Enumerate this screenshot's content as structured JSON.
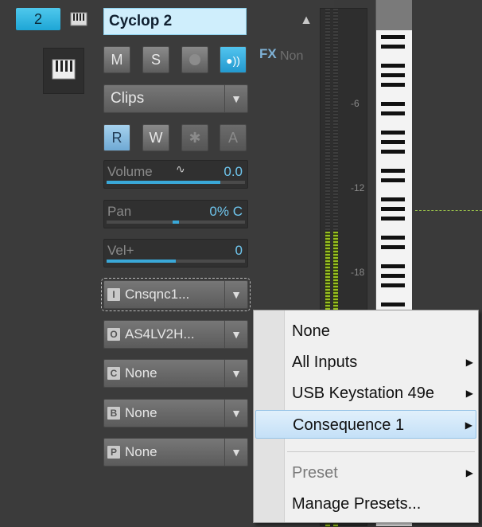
{
  "track": {
    "number": "2",
    "name": "Cyclop 2",
    "buttons": {
      "mute": "M",
      "solo": "S",
      "read": "R",
      "write": "W",
      "automation": "A"
    },
    "fx_label": "FX",
    "fx_value": "Non",
    "clips_label": "Clips",
    "volume": {
      "label": "Volume",
      "value": "0.0",
      "fill": 0.82
    },
    "pan": {
      "label": "Pan",
      "value": "0% C",
      "fill": 0.5
    },
    "vel": {
      "label": "Vel+",
      "value": "0",
      "fill": 0.5
    },
    "input": {
      "badge": "I",
      "value": "Cnsqnc1..."
    },
    "output": {
      "badge": "O",
      "value": "AS4LV2H..."
    },
    "c_route": {
      "badge": "C",
      "value": "None"
    },
    "b_route": {
      "badge": "B",
      "value": "None"
    },
    "p_route": {
      "badge": "P",
      "value": "None"
    }
  },
  "meter": {
    "ticks": [
      "-6",
      "-12",
      "-18"
    ]
  },
  "menu": {
    "items": [
      {
        "label": "None",
        "submenu": false
      },
      {
        "label": "All Inputs",
        "submenu": true
      },
      {
        "label": "USB Keystation 49e",
        "submenu": true
      },
      {
        "label": "Consequence 1",
        "submenu": true,
        "highlighted": true
      },
      {
        "label": "Preset",
        "submenu": true,
        "disabled": true
      },
      {
        "label": "Manage Presets...",
        "submenu": false
      }
    ]
  },
  "colors": {
    "accent": "#3aa8d8",
    "meter_green": "#98c020",
    "highlight": "#c4e0f7"
  }
}
